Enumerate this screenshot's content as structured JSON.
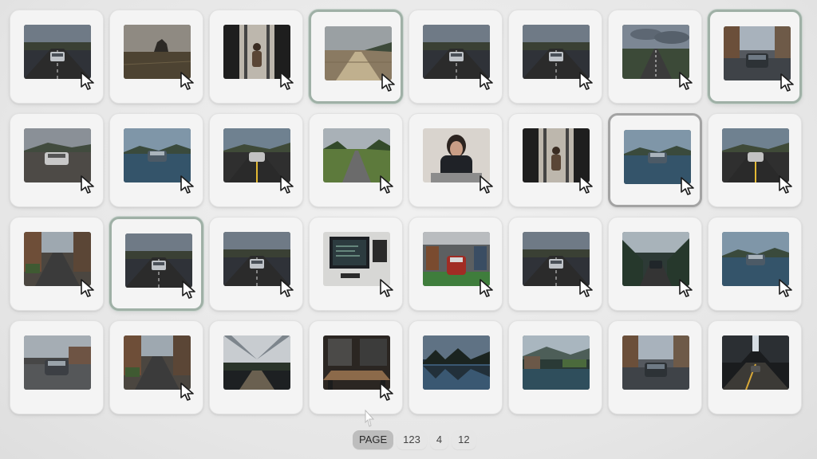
{
  "thumbnails": [
    {
      "scene": "road-car-rear",
      "selected": false,
      "hover": false
    },
    {
      "scene": "field-rock",
      "selected": false,
      "hover": false
    },
    {
      "scene": "alley-person",
      "selected": false,
      "hover": false
    },
    {
      "scene": "dirt-road",
      "selected": true,
      "hover": false
    },
    {
      "scene": "road-car-rear",
      "selected": false,
      "hover": false
    },
    {
      "scene": "road-car-rear",
      "selected": false,
      "hover": false
    },
    {
      "scene": "straight-road-clouds",
      "selected": false,
      "hover": false
    },
    {
      "scene": "city-car-front",
      "selected": true,
      "hover": false
    },
    {
      "scene": "road-car-front",
      "selected": false,
      "hover": false
    },
    {
      "scene": "lake-car",
      "selected": false,
      "hover": false
    },
    {
      "scene": "road-yellow-car",
      "selected": false,
      "hover": false
    },
    {
      "scene": "green-road",
      "selected": false,
      "hover": false
    },
    {
      "scene": "person-portrait",
      "selected": false,
      "hover": false
    },
    {
      "scene": "alley-person",
      "selected": false,
      "hover": false
    },
    {
      "scene": "lake-car",
      "selected": false,
      "hover": true
    },
    {
      "scene": "road-yellow-car",
      "selected": false,
      "hover": false
    },
    {
      "scene": "city-street",
      "selected": false,
      "hover": false
    },
    {
      "scene": "road-car-rear",
      "selected": true,
      "hover": false
    },
    {
      "scene": "road-car-rear",
      "selected": false,
      "hover": false
    },
    {
      "scene": "office-monitor",
      "selected": false,
      "hover": false
    },
    {
      "scene": "garage-red-car",
      "selected": false,
      "hover": false
    },
    {
      "scene": "road-car-rear",
      "selected": false,
      "hover": false
    },
    {
      "scene": "mountain-car",
      "selected": false,
      "hover": false
    },
    {
      "scene": "lake-car",
      "selected": false,
      "hover": false
    },
    {
      "scene": "street-car",
      "selected": false,
      "hover": false
    },
    {
      "scene": "city-street",
      "selected": false,
      "hover": false
    },
    {
      "scene": "canal-sky",
      "selected": false,
      "hover": false
    },
    {
      "scene": "office-table",
      "selected": false,
      "hover": false
    },
    {
      "scene": "lake-mountain",
      "selected": false,
      "hover": false
    },
    {
      "scene": "village-lake",
      "selected": false,
      "hover": false
    },
    {
      "scene": "city-car-front",
      "selected": false,
      "hover": false
    },
    {
      "scene": "tunnel-road",
      "selected": false,
      "hover": false
    }
  ],
  "cursor_rows": [
    0,
    1,
    2
  ],
  "cursor_row3_cols": [
    1,
    3
  ],
  "pagination": {
    "label": "PAGE",
    "items": [
      "123",
      "4",
      "12"
    ]
  },
  "icons": {
    "cursor": "arrow-cursor-icon",
    "bottom_arrow": "pointer-arrow-icon"
  }
}
